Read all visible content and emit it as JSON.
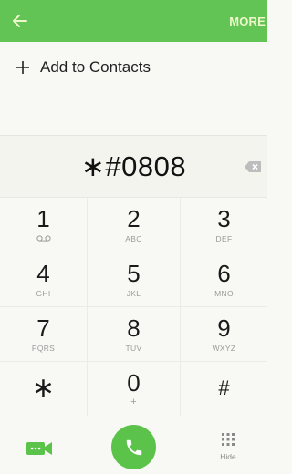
{
  "header": {
    "back_icon": "arrow-left-icon",
    "more_label": "MORE",
    "bar_color": "#61c454"
  },
  "add_contact": {
    "icon": "plus-icon",
    "label": "Add to Contacts"
  },
  "number_display": {
    "value": "∗#0808",
    "delete_icon": "backspace-icon"
  },
  "keypad": {
    "keys": [
      {
        "digit": "1",
        "sub": ""
      },
      {
        "digit": "2",
        "sub": "ABC"
      },
      {
        "digit": "3",
        "sub": "DEF"
      },
      {
        "digit": "4",
        "sub": "GHI"
      },
      {
        "digit": "5",
        "sub": "JKL"
      },
      {
        "digit": "6",
        "sub": "MNO"
      },
      {
        "digit": "7",
        "sub": "PQRS"
      },
      {
        "digit": "8",
        "sub": "TUV"
      },
      {
        "digit": "9",
        "sub": "WXYZ"
      },
      {
        "digit": "∗",
        "sub": ""
      },
      {
        "digit": "0",
        "sub": "+"
      },
      {
        "digit": "#",
        "sub": ""
      }
    ]
  },
  "bottom": {
    "video_icon": "video-call-icon",
    "call_icon": "phone-icon",
    "call_color": "#5bc24a",
    "hide_icon": "dialpad-icon",
    "hide_label": "Hide"
  }
}
